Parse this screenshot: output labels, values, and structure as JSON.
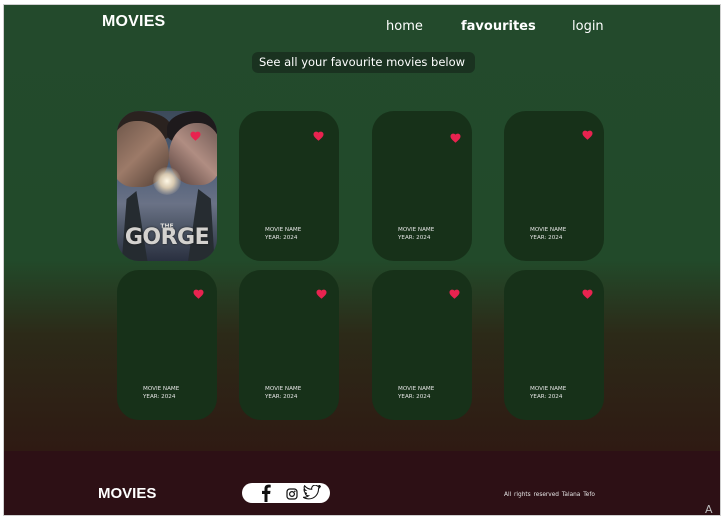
{
  "header": {
    "logo": "MOVIES",
    "nav": [
      "home",
      "favourites",
      "login"
    ]
  },
  "intro_text": "See all your favourite movies below",
  "cards": [
    {
      "poster_title": "GORGE",
      "poster_the": "THE",
      "favourite": true
    },
    {
      "name": "MOVIE NAME",
      "year": "YEAR: 2024",
      "favourite": true
    },
    {
      "name": "MOVIE NAME",
      "year": "YEAR: 2024",
      "favourite": true
    },
    {
      "name": "MOVIE NAME",
      "year": "YEAR: 2024",
      "favourite": true
    },
    {
      "name": "MOVIE NAME",
      "year": "YEAR: 2024",
      "favourite": true
    },
    {
      "name": "MOVIE NAME",
      "year": "YEAR: 2024",
      "favourite": true
    },
    {
      "name": "MOVIE NAME",
      "year": "YEAR: 2024",
      "favourite": true
    },
    {
      "name": "MOVIE NAME",
      "year": "YEAR: 2024",
      "favourite": true
    }
  ],
  "footer": {
    "logo": "MOVIES",
    "social": [
      "facebook-icon",
      "instagram-icon",
      "twitter-icon"
    ],
    "rights": "All rights reserved",
    "author": "Talana Tefo"
  },
  "corner_mark": "A",
  "colors": {
    "page_bg_top": "#234a2c",
    "page_bg_bottom": "#2f1a13",
    "card_bg": "#173119",
    "heart": "#e8234f",
    "footer_bg": "#2d1015"
  }
}
